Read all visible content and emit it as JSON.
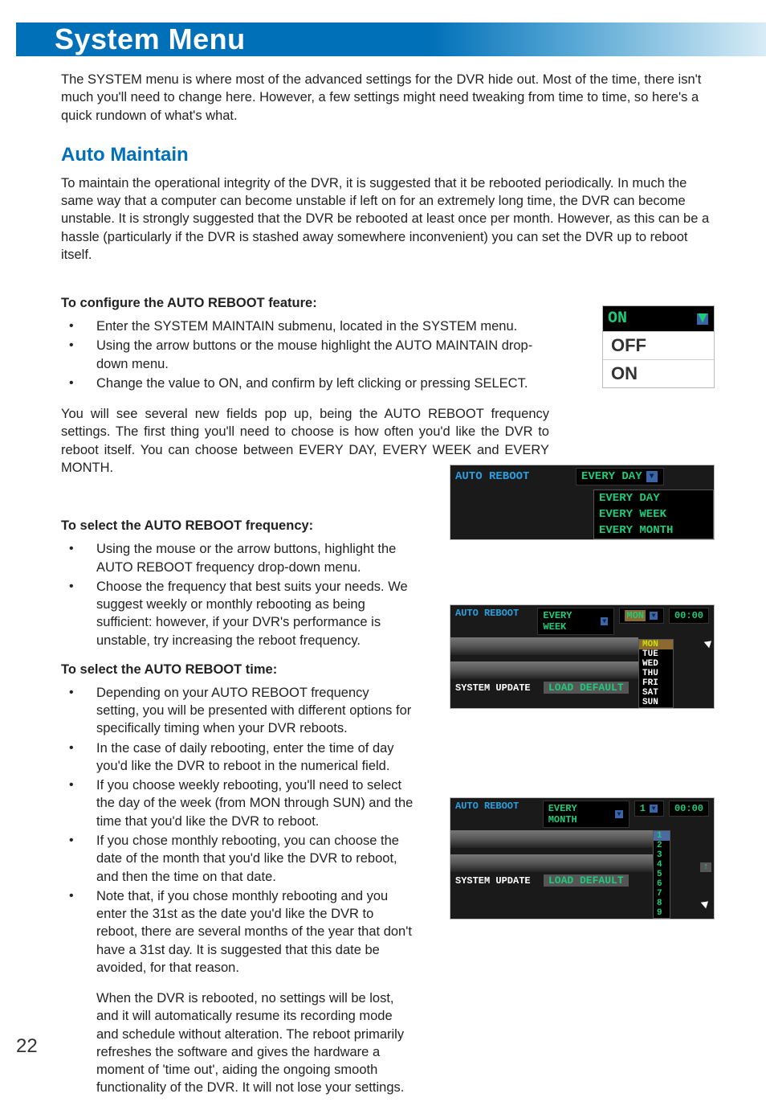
{
  "banner": {
    "title": "System Menu"
  },
  "intro": "The SYSTEM menu is where most of the advanced settings for the DVR hide out. Most of the time, there isn't much you'll need to change here. However, a few settings might need tweaking from time to time, so here's a quick rundown of what's what.",
  "section": {
    "heading": "Auto Maintain",
    "para1": "To maintain the operational integrity of the DVR, it is suggested that it be rebooted periodically. In much the same way that a computer can become unstable if left on for an extremely long time, the DVR can become unstable. It is strongly suggested that the DVR be rebooted at least once per month. However, as this can be a hassle (particularly if the DVR is stashed away somewhere inconvenient) you can set the DVR up to reboot itself."
  },
  "configure": {
    "heading": "To configure the AUTO REBOOT feature:",
    "bullets": [
      "Enter the SYSTEM MAINTAIN submenu, located in the SYSTEM menu.",
      "Using the arrow buttons or the mouse highlight the AUTO MAINTAIN drop-down menu.",
      "Change the value to ON, and confirm by left clicking or pressing SELECT."
    ],
    "after": "You will see several new fields pop up, being the AUTO REBOOT frequency settings. The first thing you'll need to choose is how often you'd like the DVR to reboot itself. You can choose between EVERY DAY, EVERY WEEK and EVERY MONTH."
  },
  "frequency": {
    "heading": "To select the AUTO REBOOT frequency:",
    "bullets": [
      "Using the mouse or the arrow buttons, highlight the AUTO REBOOT frequency drop-down menu.",
      "Choose the frequency that best suits your needs. We suggest weekly or monthly rebooting as being sufficient: however, if your DVR's performance is unstable, try increasing the reboot frequency."
    ]
  },
  "time": {
    "heading": "To select the AUTO REBOOT time:",
    "bullets": [
      "Depending on your AUTO REBOOT frequency setting, you will be presented with different options for specifically timing when your DVR reboots.",
      "In the case of daily rebooting, enter the time of day you'd like the DVR to reboot in the numerical field.",
      "If you choose weekly rebooting, you'll need to select the day of the week (from MON through SUN) and the time that you'd like the DVR to reboot.",
      "If you chose monthly rebooting, you can choose the date of the month that you'd like the DVR to reboot, and then the time on that date.",
      "Note that, if you chose monthly rebooting and you enter the 31st as the date you'd like the DVR to reboot, there are several months of the year that don't have a 31st day. It is suggested that this date be avoided, for that reason."
    ],
    "closing": "When the DVR is rebooted, no settings will be lost, and it will automatically resume its recording mode and schedule without alteration. The reboot primarily refreshes the software and gives the hardware a moment of 'time out', aiding the ongoing smooth functionality of the DVR. It will not lose your settings."
  },
  "onoff_dropdown": {
    "selected": "ON",
    "options": [
      "OFF",
      "ON"
    ]
  },
  "freq_shot": {
    "label": "AUTO REBOOT",
    "selected": "EVERY DAY",
    "options": [
      "EVERY DAY",
      "EVERY WEEK",
      "EVERY MONTH"
    ]
  },
  "week_shot": {
    "label1": "AUTO REBOOT",
    "value1": "EVERY WEEK",
    "day_selected": "MON",
    "days": [
      "MON",
      "TUE",
      "WED",
      "THU",
      "FRI",
      "SAT",
      "SUN"
    ],
    "time": "00:00",
    "label2": "SYSTEM UPDATE",
    "button": "LOAD DEFAULT"
  },
  "month_shot": {
    "label1": "AUTO REBOOT",
    "value1": "EVERY MONTH",
    "date_selected": "1",
    "dates": [
      "1",
      "2",
      "3",
      "4",
      "5",
      "6",
      "7",
      "8",
      "9"
    ],
    "time": "00:00",
    "label2": "SYSTEM UPDATE",
    "button": "LOAD DEFAULT"
  },
  "page_number": "22"
}
